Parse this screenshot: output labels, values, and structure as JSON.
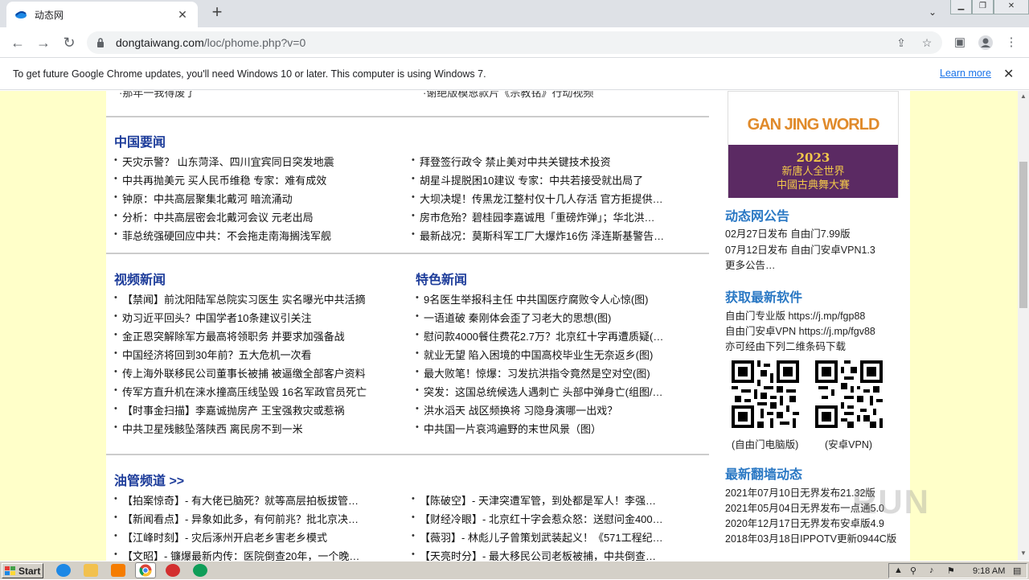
{
  "browser": {
    "tab_title": "动态网",
    "url_host": "dongtaiwang.com",
    "url_path": "/loc/phome.php?v=0",
    "infobar_text": "To get future Google Chrome updates, you'll need Windows 10 or later. This computer is using Windows 7.",
    "learn_more": "Learn more"
  },
  "page": {
    "top_left": "·那年一我得废了",
    "top_right": "·谢绝版模恩款片《宗教铭》行动视频",
    "china_news": {
      "title": "中国要闻",
      "left": [
        "天灾示警？ 山东菏泽、四川宜宾同日突发地震",
        "中共再抛美元 买人民币维稳 专家：难有成效",
        "钟原：中共高层聚集北戴河 暗流涌动",
        "分析：中共高层密会北戴河会议 元老出局",
        "菲总统强硬回应中共：不会拖走南海搁浅军舰"
      ],
      "right": [
        "拜登签行政令 禁止美对中共关键技术投资",
        "胡星斗提脱困10建议 专家：中共若接受就出局了",
        "大坝决堤！传黑龙江整村仅十几人存活 官方拒提供…",
        "房市危殆？碧桂园李嘉诚甩「重磅炸弹」；华北洪…",
        "最新战况：莫斯科军工厂大爆炸16伤 泽连斯基警告…"
      ]
    },
    "video_news": {
      "title": "视频新闻",
      "items": [
        "【禁闻】前沈阳陆军总院实习医生 实名曝光中共活摘",
        "劝习近平回头？中国学者10条建议引关注",
        "金正恩突解除军方最高将领职务 并要求加强备战",
        "中国经济将回到30年前？五大危机一次看",
        "传上海外联移民公司董事长被捕 被逼缴全部客户资料",
        "传军方直升机在涞水撞高压线坠毁 16名军政官员死亡",
        "【时事金扫描】李嘉诚抛房产 王宝强救灾或惹祸",
        "中共卫星残骸坠落陕西 离民房不到一米"
      ]
    },
    "special_news": {
      "title": "特色新闻",
      "items": [
        "9名医生举报科主任 中共国医疗腐败令人心惊(图)",
        "一语道破 秦刚体会歪了习老大的思想(图)",
        "慰问款4000餐住费花2.7万？北京红十字再遭质疑(…",
        "就业无望 陷入困境的中国高校毕业生无奈返乡(图)",
        "最大败笔！惊爆：习发抗洪指令竟然是空对空(图)",
        "突发：这国总统候选人遇刺亡 头部中弹身亡(组图/…",
        "洪水滔天 战区频换将 习隐身演哪一出戏？",
        "中共国一片哀鸿遍野的末世风景（图）"
      ]
    },
    "youguan": {
      "title": "油管频道 >>",
      "left": [
        "【拍案惊奇】- 有大佬已脑死？就等高层拍板拔管…",
        "【新闻看点】- 异象如此多，有何前兆？批北京决…",
        "【江峰时刻】- 灾后涿州开启老乡害老乡模式",
        "【文昭】- 镰爆最新内传：医院倒查20年，一个晚…"
      ],
      "right": [
        "【陈破空】- 天津突遭军管，到处都是军人！李强…",
        "【财经冷眼】- 北京红十字会惹众怒：送慰问金400…",
        "【薇羽】- 林彪儿子曾策划武装起义！《571工程纪…",
        "【天亮时分】- 最大移民公司老板被捕，中共倒查…"
      ]
    },
    "sidebar": {
      "banner_logo": "GAN JING WORLD",
      "banner_year": "2023",
      "banner_line1": "新唐人全世界",
      "banner_line2": "中國古典舞大賽",
      "announce_title": "动态网公告",
      "announce": [
        "02月27日发布 自由门7.99版",
        "07月12日发布 自由门安卓VPN1.3",
        "更多公告…"
      ],
      "software_title": "获取最新软件",
      "software": [
        "自由门专业版 https://j.mp/fgp88",
        "自由门安卓VPN https://j.mp/fgv88",
        "亦可经由下列二维条码下载"
      ],
      "qr_left": "(自由门电脑版)",
      "qr_right": "(安卓VPN)",
      "latest_title": "最新翻墙动态",
      "latest": [
        "2021年07月10日无界发布21.32版",
        "2021年05月04日无界发布一点通5.0",
        "2020年12月17日无界发布安卓版4.9",
        "2018年03月18日IPPOTV更新0944C版"
      ]
    }
  },
  "taskbar": {
    "start": "Start",
    "time": "9:18 AM"
  },
  "watermark": "RUN"
}
